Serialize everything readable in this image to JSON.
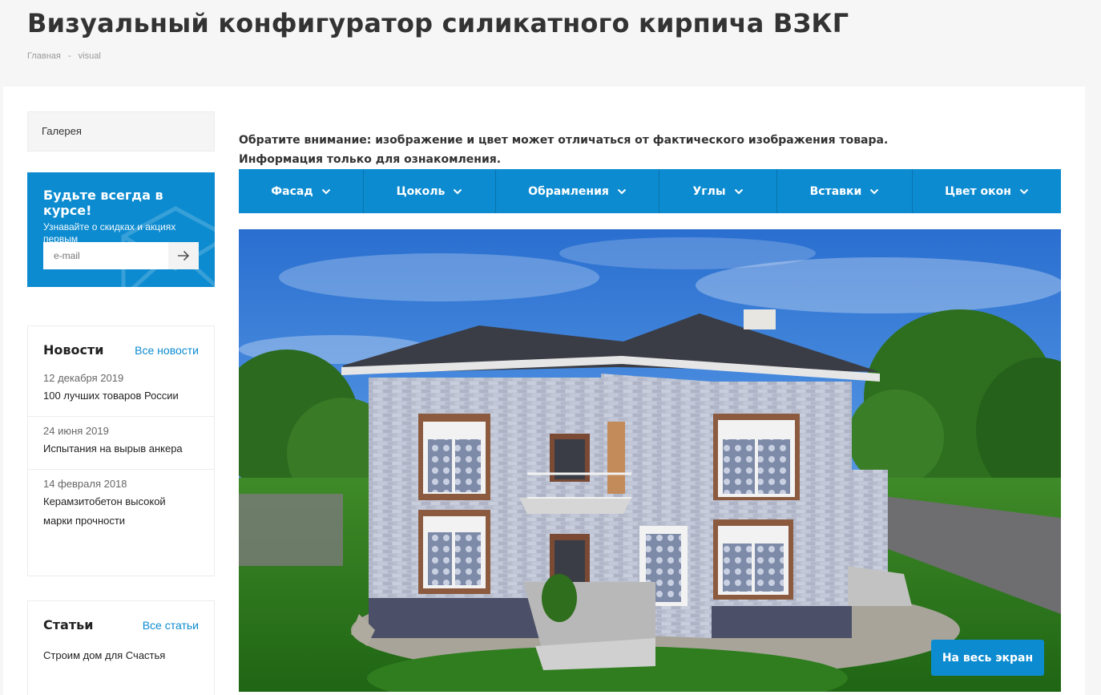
{
  "header": {
    "title": "Визуальный конфигуратор силикатного кирпича ВЗКГ",
    "breadcrumb": [
      "Главная",
      "-",
      "visual"
    ]
  },
  "sidebar": {
    "gallery_label": "Галерея",
    "subscribe": {
      "title": "Будьте всегда в курсе!",
      "text": "Узнавайте о скидках и акциях первым",
      "email_placeholder": "e-mail"
    },
    "news": {
      "title": "Новости",
      "all_link": "Все новости",
      "items": [
        {
          "date": "12 декабря 2019",
          "title": "100 лучших товаров России"
        },
        {
          "date": "24 июня 2019",
          "title": "Испытания на вырыв анкера"
        },
        {
          "date": "14 февраля 2018",
          "title": "Керамзитобетон высокой марки прочности"
        }
      ]
    },
    "articles": {
      "title": "Статьи",
      "all_link": "Все статьи",
      "items": [
        {
          "title": "Строим дом для Счастья"
        }
      ]
    }
  },
  "main": {
    "notice_line1": "Обратите внимание: изображение и цвет может отличаться от фактического изображения товара.",
    "notice_line2": "Информация только для ознакомления.",
    "menu": [
      {
        "label": "Фасад"
      },
      {
        "label": "Цоколь"
      },
      {
        "label": "Обрамления"
      },
      {
        "label": "Углы"
      },
      {
        "label": "Вставки"
      },
      {
        "label": "Цвет окон"
      }
    ],
    "fullscreen_label": "На весь экран"
  },
  "colors": {
    "accent": "#0c8bd0",
    "roof": "#3a3d46",
    "brick": "#b9bfcf",
    "plinth": "#4b5068",
    "grass": "#2f7d1f",
    "sky": "#2f7fd8"
  }
}
